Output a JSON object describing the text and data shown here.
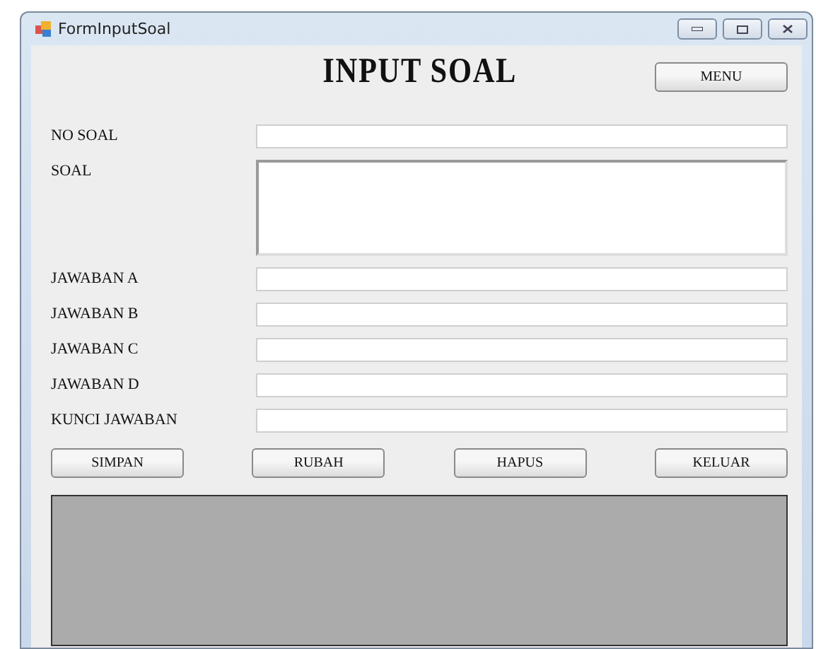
{
  "window": {
    "title": "FormInputSoal"
  },
  "heading": "INPUT SOAL",
  "menu_button": "MENU",
  "fields": [
    {
      "label": "NO SOAL",
      "kind": "line"
    },
    {
      "label": "SOAL",
      "kind": "multiline"
    },
    {
      "label": "JAWABAN A",
      "kind": "line"
    },
    {
      "label": "JAWABAN B",
      "kind": "line"
    },
    {
      "label": "JAWABAN C",
      "kind": "line"
    },
    {
      "label": "JAWABAN D",
      "kind": "line"
    },
    {
      "label": "KUNCI JAWABAN",
      "kind": "line"
    }
  ],
  "buttons": [
    "SIMPAN",
    "RUBAH",
    "HAPUS",
    "KELUAR"
  ]
}
